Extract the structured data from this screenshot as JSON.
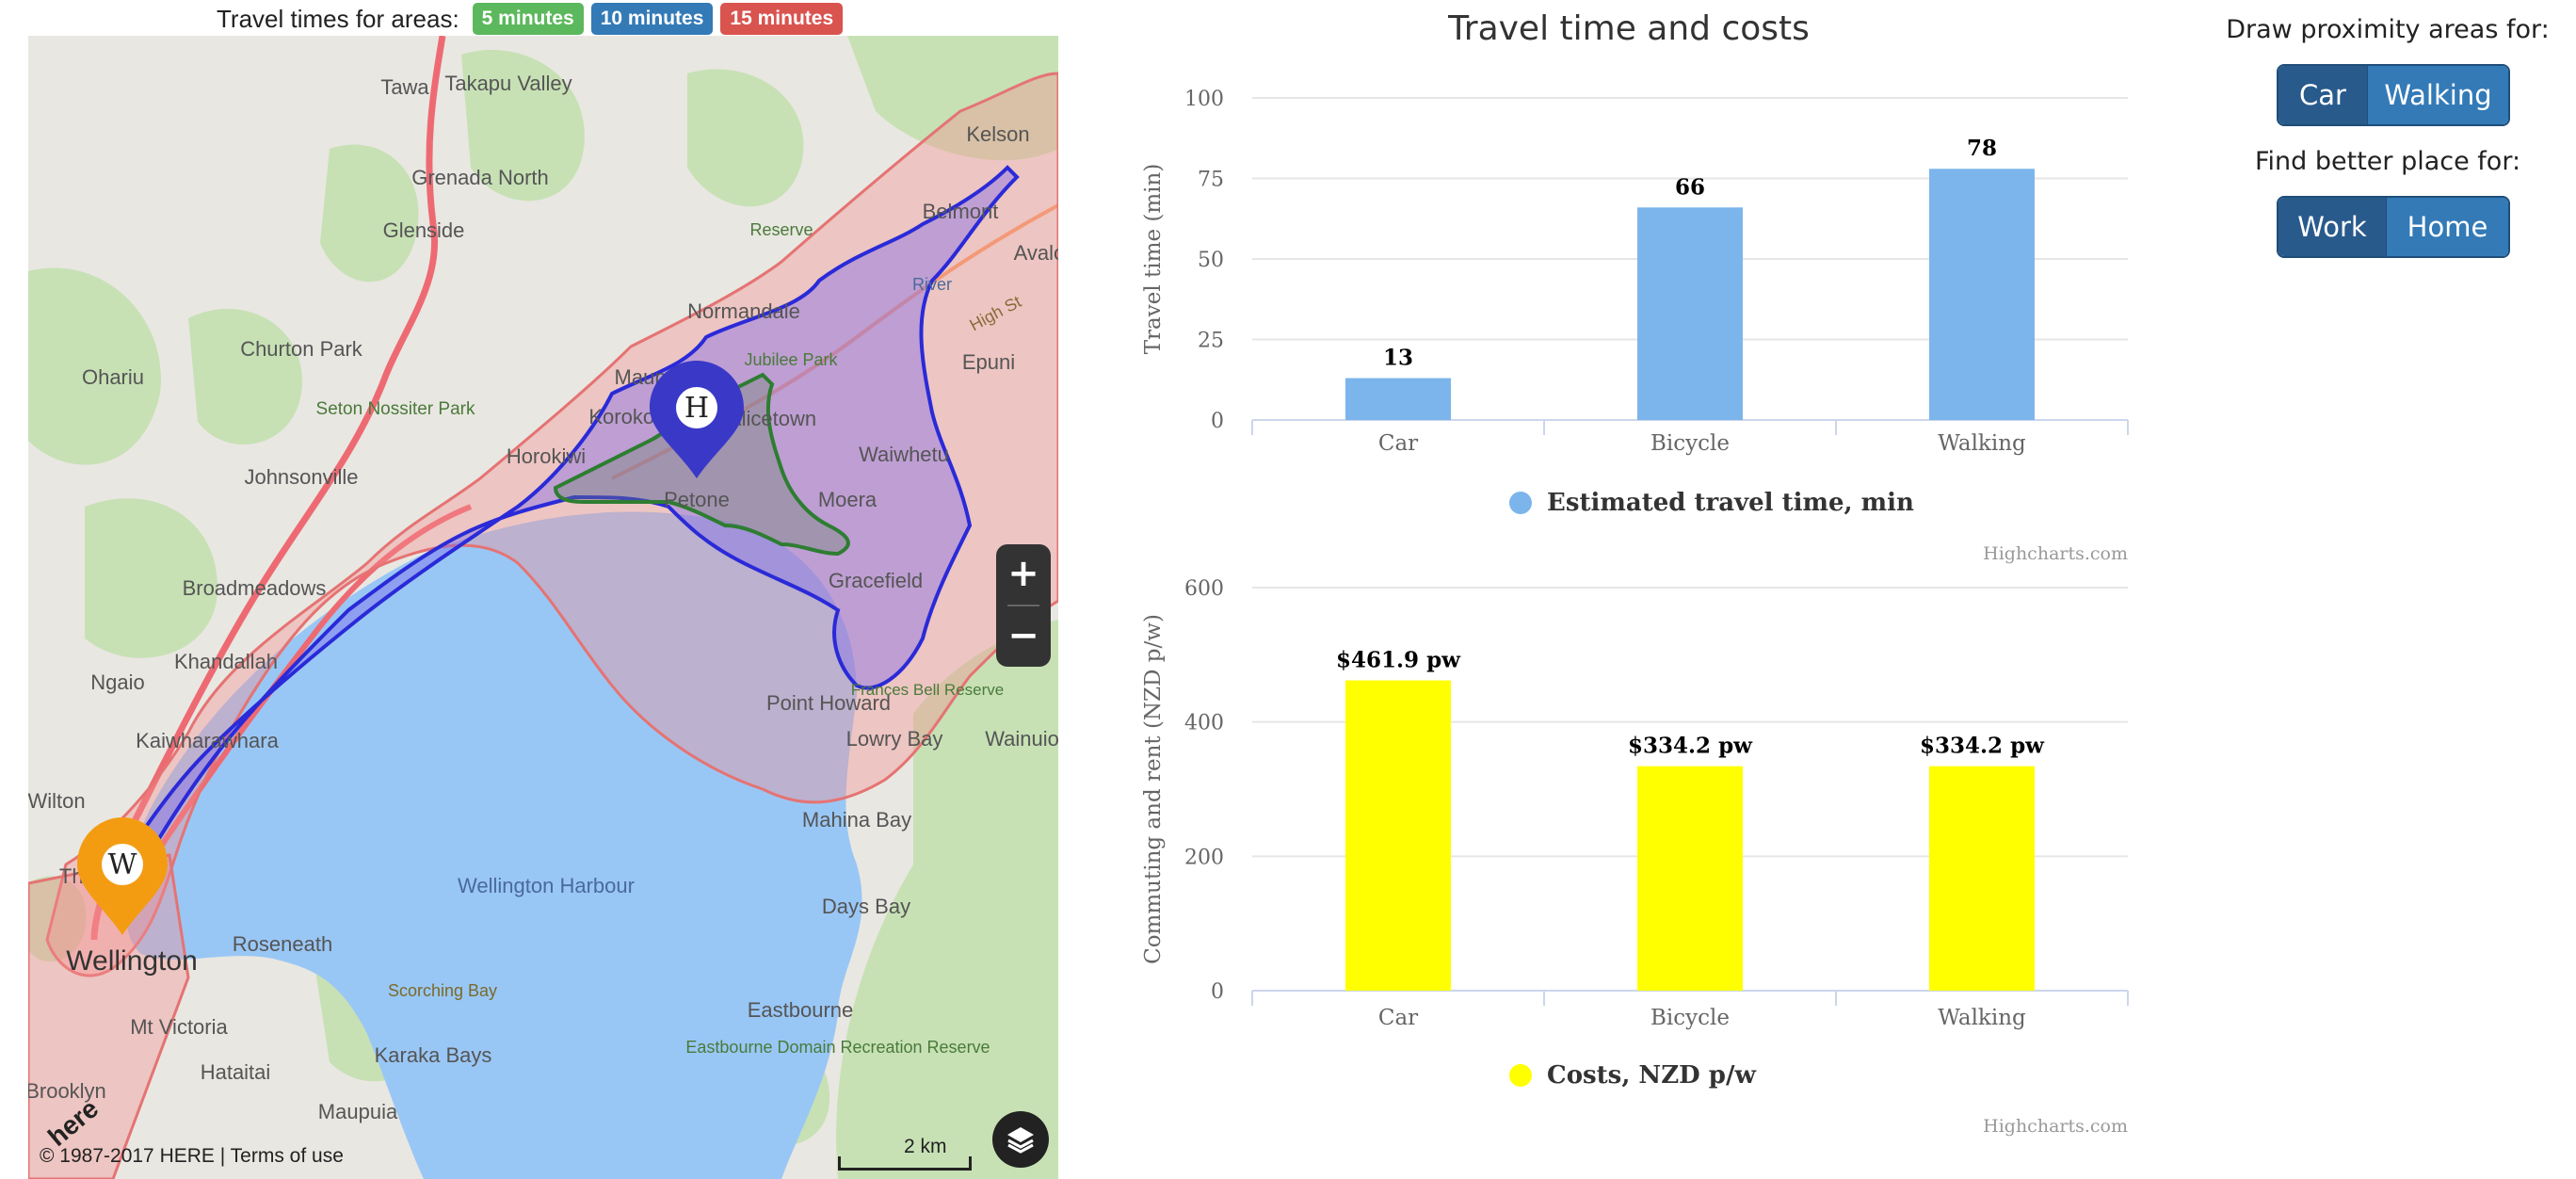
{
  "legend": {
    "title": "Travel times for areas:",
    "tags": [
      {
        "label": "5 minutes",
        "color": "#5cb85c"
      },
      {
        "label": "10 minutes",
        "color": "#337ab7"
      },
      {
        "label": "15 minutes",
        "color": "#d9534f"
      }
    ]
  },
  "map": {
    "place_labels": [
      "Takapu Valley",
      "Tawa",
      "Grenada North",
      "Glenside",
      "Churton Park",
      "Ohariu",
      "Seton Nossiter Park",
      "Johnsonville",
      "Broadmeadows",
      "Ngaio",
      "Khandallah",
      "Kaiwharawhara",
      "Wilton",
      "Thorndon",
      "Wellington",
      "Roseneath",
      "Mt Victoria",
      "Hataitai",
      "Brooklyn",
      "Karaka Bays",
      "Maupuia",
      "Scorching Bay",
      "Wellington Harbour",
      "Eastbourne",
      "Eastbourne Domain Recreation Reserve",
      "Days Bay",
      "Mahina Bay",
      "Lowry Bay",
      "Point Howard",
      "Gracefield",
      "Moera",
      "Petone",
      "Korokoro",
      "Maungaraki",
      "Normandale",
      "Horokiwi",
      "Alicetown",
      "Jubilee Park",
      "Waiwhetu",
      "Epuni",
      "Belmont",
      "Kelson",
      "Avalon",
      "Wainuiomata",
      "Reserve",
      "High St",
      "River",
      "Frances Bell Reserve"
    ],
    "markers": {
      "home": "H",
      "work": "W"
    },
    "zoom_in": "+",
    "zoom_out": "−",
    "copyright": "© 1987-2017 HERE",
    "terms": "Terms of use",
    "scale": "2 km",
    "brand": "here",
    "colors": {
      "water": "#99c7f5",
      "land": "#e8e6e1",
      "park": "#c5e0b4",
      "area15_stroke": "#e57373",
      "area15_fill": "rgba(244,143,143,0.38)",
      "area10_stroke": "#2a2ad8",
      "area10_fill": "rgba(126,104,236,0.42)",
      "area5_stroke": "#2e7d32",
      "area5_fill": "rgba(110,130,110,0.35)",
      "home_marker": "#3a38c7",
      "work_marker": "#f39c12"
    }
  },
  "charts": {
    "title": "Travel time and costs",
    "credits": "Highcharts.com"
  },
  "chart_data": [
    {
      "type": "bar",
      "categories": [
        "Car",
        "Bicycle",
        "Walking"
      ],
      "values": [
        13,
        66,
        78
      ],
      "data_labels": [
        "13",
        "66",
        "78"
      ],
      "ylabel": "Travel time (min)",
      "ylim": [
        0,
        100
      ],
      "yticks": [
        0,
        25,
        50,
        75,
        100
      ],
      "series_name": "Estimated travel time, min",
      "color": "#7cb5ec",
      "grid": true,
      "legend": "bottom-center"
    },
    {
      "type": "bar",
      "categories": [
        "Car",
        "Bicycle",
        "Walking"
      ],
      "values": [
        461.9,
        334.2,
        334.2
      ],
      "data_labels": [
        "$461.9 pw",
        "$334.2 pw",
        "$334.2 pw"
      ],
      "ylabel": "Commuting and rent (NZD p/w)",
      "ylim": [
        0,
        600
      ],
      "yticks": [
        0,
        200,
        400,
        600
      ],
      "series_name": "Costs, NZD p/w",
      "color": "#ffff00",
      "grid": true,
      "legend": "bottom-center"
    }
  ],
  "controls": {
    "proximity_label": "Draw proximity areas for:",
    "proximity_buttons": [
      "Car",
      "Walking"
    ],
    "better_label": "Find better place for:",
    "better_buttons": [
      "Work",
      "Home"
    ]
  }
}
